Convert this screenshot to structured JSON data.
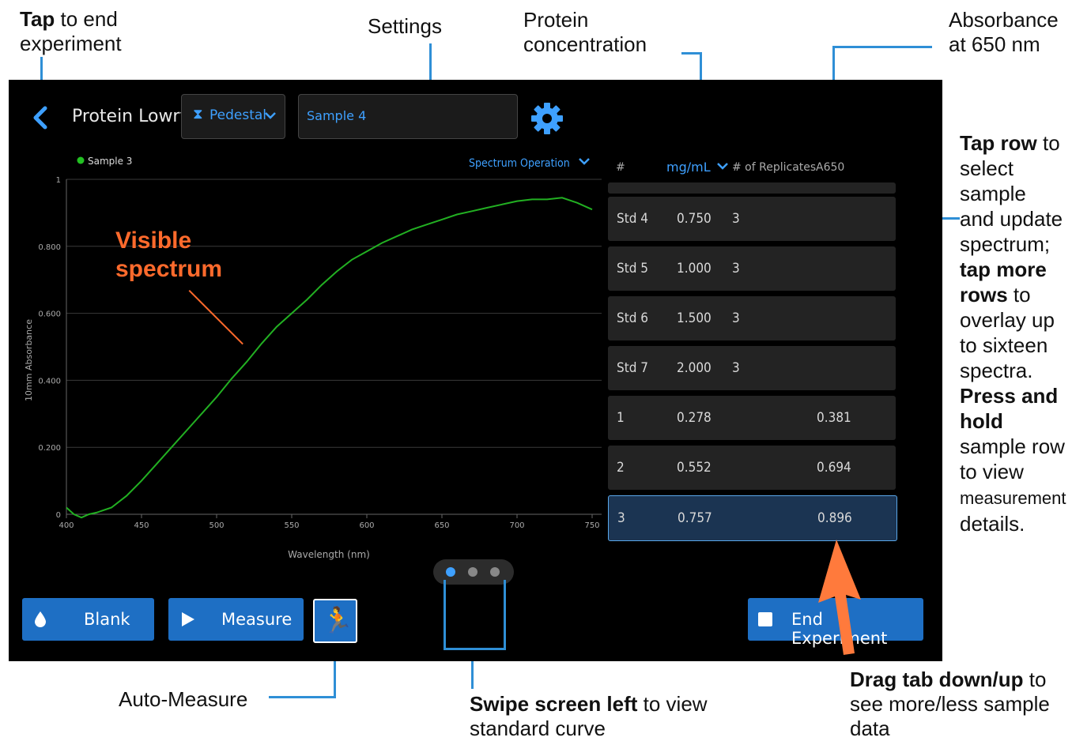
{
  "callouts": {
    "end_experiment": {
      "bold": "Tap",
      "rest": " to end",
      "line2": "experiment"
    },
    "settings": "Settings",
    "protein_conc": {
      "line1": "Protein",
      "line2": "concentration"
    },
    "absorbance": {
      "line1": "Absorbance",
      "line2": "at 650 nm"
    },
    "tap_row": {
      "b1": "Tap row",
      "t1": " to",
      "t2": "select",
      "t3": "sample",
      "t4": "and update",
      "t5": "spectrum;",
      "b2": "tap more",
      "b3": "rows",
      "t6": " to",
      "t7": "overlay up",
      "t8": "to sixteen",
      "t9": "spectra.",
      "b4": "Press and",
      "b5": "hold",
      "t10": "sample row",
      "t11": "to view",
      "t12": "measurement",
      "t13": "details."
    },
    "auto_measure": "Auto-Measure",
    "swipe": {
      "bold": "Swipe screen left",
      "rest": " to view",
      "line2": "standard curve"
    },
    "drag": {
      "bold": "Drag tab down/up",
      "rest": " to",
      "line2": "see more/less sample",
      "line3": "data"
    },
    "visible_spectrum": {
      "line1": "Visible",
      "line2": "spectrum"
    }
  },
  "app": {
    "title": "Protein Lowry",
    "mode": "Pedestal",
    "sample_name": "Sample 4",
    "spectrum_menu": "Spectrum Operation"
  },
  "table": {
    "headers": {
      "num": "#",
      "unit": "mg/mL",
      "replicates": "# of Replicates",
      "a650": "A650"
    },
    "rows": [
      {
        "id": "Std 4",
        "conc": "0.750",
        "reps": "3",
        "a650": ""
      },
      {
        "id": "Std 5",
        "conc": "1.000",
        "reps": "3",
        "a650": ""
      },
      {
        "id": "Std 6",
        "conc": "1.500",
        "reps": "3",
        "a650": ""
      },
      {
        "id": "Std 7",
        "conc": "2.000",
        "reps": "3",
        "a650": ""
      },
      {
        "id": "1",
        "conc": "0.278",
        "reps": "",
        "a650": "0.381"
      },
      {
        "id": "2",
        "conc": "0.552",
        "reps": "",
        "a650": "0.694"
      },
      {
        "id": "3",
        "conc": "0.757",
        "reps": "",
        "a650": "0.896"
      }
    ]
  },
  "buttons": {
    "blank": "Blank",
    "measure": "Measure",
    "end": "End Experiment"
  },
  "colors": {
    "accent": "#3ea0ff",
    "button": "#1e6fc4",
    "callout_line": "#2f8fd6",
    "spectrum": "#22b022",
    "highlight": "#ff7a3c"
  },
  "pager": {
    "pages": 3,
    "active": 0
  },
  "chart_data": {
    "type": "line",
    "legend": "Sample 3",
    "xlabel": "Wavelength (nm)",
    "ylabel": "10mm Absorbance",
    "xlim": [
      400,
      750
    ],
    "ylim": [
      0,
      1
    ],
    "xticks": [
      "400",
      "450",
      "500",
      "550",
      "600",
      "650",
      "700",
      "750"
    ],
    "yticks": [
      "0",
      "0.200",
      "0.400",
      "0.600",
      "0.800",
      "1"
    ],
    "series": [
      {
        "name": "Sample 3",
        "x": [
          400,
          405,
          410,
          415,
          420,
          430,
          440,
          450,
          460,
          470,
          480,
          490,
          500,
          510,
          520,
          530,
          540,
          550,
          560,
          570,
          580,
          590,
          600,
          610,
          620,
          630,
          640,
          650,
          660,
          670,
          680,
          690,
          700,
          710,
          720,
          730,
          740,
          750
        ],
        "y": [
          0.02,
          0.0,
          -0.01,
          0.0,
          0.005,
          0.02,
          0.055,
          0.1,
          0.15,
          0.2,
          0.25,
          0.3,
          0.35,
          0.405,
          0.455,
          0.51,
          0.56,
          0.6,
          0.64,
          0.685,
          0.725,
          0.76,
          0.785,
          0.81,
          0.83,
          0.85,
          0.865,
          0.88,
          0.895,
          0.905,
          0.915,
          0.925,
          0.935,
          0.94,
          0.94,
          0.945,
          0.93,
          0.91
        ]
      }
    ]
  }
}
